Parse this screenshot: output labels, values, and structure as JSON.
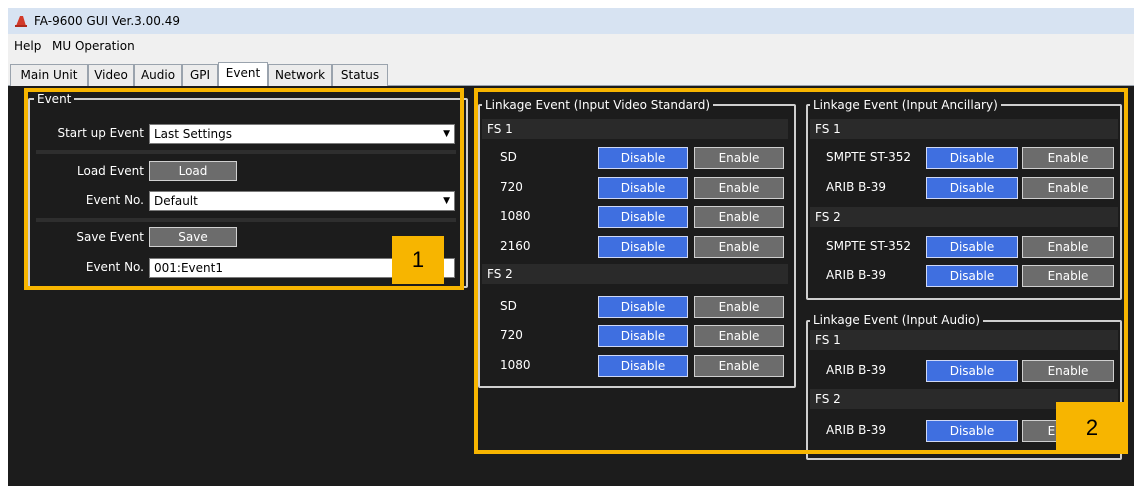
{
  "window": {
    "title": "FA-9600 GUI Ver.3.00.49"
  },
  "menu": [
    "Help",
    "MU Operation"
  ],
  "tabs": [
    "Main Unit",
    "Video",
    "Audio",
    "GPI",
    "Event",
    "Network",
    "Status"
  ],
  "active_tab": "Event",
  "event": {
    "group_title": "Event",
    "startup_label": "Start up Event",
    "startup_value": "Last Settings",
    "load_label": "Load Event",
    "load_button": "Load",
    "event_no_label": "Event No.",
    "load_event_no": "Default",
    "save_label": "Save Event",
    "save_button": "Save",
    "save_event_no": "001:Event1"
  },
  "video": {
    "group_title": "Linkage Event (Input Video Standard)",
    "fs1": "FS 1",
    "fs2": "FS 2",
    "fs1_rows": [
      "SD",
      "720",
      "1080",
      "2160"
    ],
    "fs2_rows": [
      "SD",
      "720",
      "1080"
    ]
  },
  "ancillary": {
    "group_title": "Linkage Event (Input Ancillary)",
    "fs1": "FS 1",
    "fs2": "FS 2",
    "rows": [
      "SMPTE ST-352",
      "ARIB B-39"
    ]
  },
  "audio": {
    "group_title": "Linkage Event (Input Audio)",
    "fs1": "FS 1",
    "fs2": "FS 2",
    "row": "ARIB B-39"
  },
  "buttons": {
    "disable": "Disable",
    "enable": "Enable"
  },
  "callouts": {
    "one": "1",
    "two": "2"
  },
  "colors": {
    "highlight": "#f7b500",
    "disable_active": "#3f6fe0",
    "enable_inactive": "#6c6c6c",
    "background": "#1c1c1c"
  }
}
